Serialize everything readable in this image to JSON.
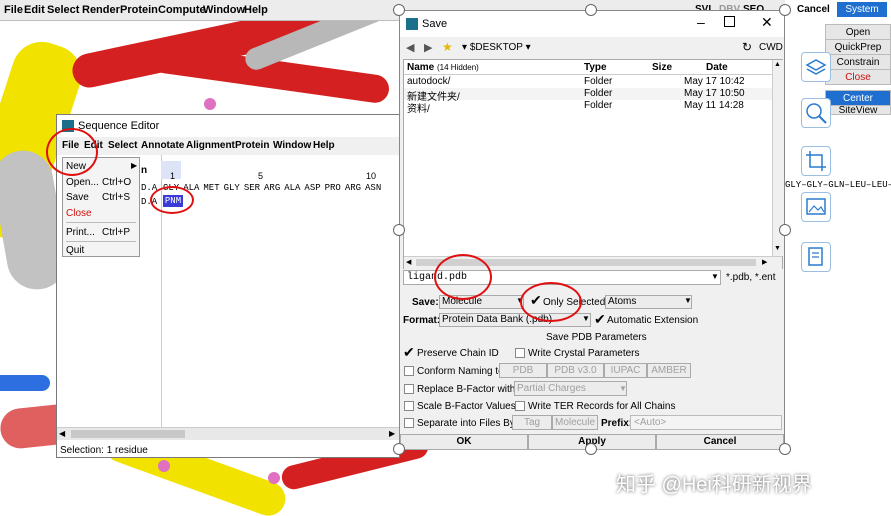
{
  "main_menu": [
    "File",
    "Edit",
    "Select",
    "Render",
    "Protein",
    "Compute",
    "Window",
    "Help"
  ],
  "right_panel": {
    "top_labels": [
      "SVL",
      "DBV",
      "SEQ"
    ],
    "cancel": "Cancel",
    "system": "System",
    "buttons": [
      "Open",
      "QuickPrep",
      "Constrain",
      "Close",
      "Center",
      "SiteView"
    ]
  },
  "seq_editor": {
    "title": "Sequence Editor",
    "menu": [
      "File",
      "Edit",
      "Select",
      "Annotate",
      "Alignment",
      "Protein",
      "Window",
      "Help"
    ],
    "dropdown": [
      {
        "label": "New",
        "shortcut": ""
      },
      {
        "label": "Open...",
        "shortcut": "Ctrl+O"
      },
      {
        "label": "Save",
        "shortcut": "Ctrl+S"
      },
      {
        "label": "Close",
        "shortcut": ""
      },
      {
        "label": "Print...",
        "shortcut": "Ctrl+P"
      },
      {
        "label": "Quit",
        "shortcut": ""
      }
    ],
    "ruler": [
      "1",
      "5",
      "10"
    ],
    "chain_label": "n",
    "row_prefix_1": "D.A",
    "row_prefix_2": "D.A",
    "residues": [
      "GLY",
      "ALA",
      "MET",
      "GLY",
      "SER",
      "ARG",
      "ALA",
      "ASP",
      "PRO",
      "ARG",
      "ASN"
    ],
    "ligand": "PNM",
    "status": "Selection:  1 residue",
    "right_seq": "GLY–GLY–GLN–LEU–LEU–"
  },
  "save_dialog": {
    "title": "Save",
    "path": "$DESKTOP",
    "cwd": "CWD",
    "columns": {
      "name": "Name",
      "hidden": "(14 Hidden)",
      "type": "Type",
      "size": "Size",
      "date": "Date"
    },
    "files": [
      {
        "name": "autodock/",
        "type": "Folder",
        "size": "",
        "date": "May 17 10:42"
      },
      {
        "name": "新建文件夹/",
        "type": "Folder",
        "size": "",
        "date": "May 17 10:50"
      },
      {
        "name": "资料/",
        "type": "Folder",
        "size": "",
        "date": "May 11 14:28"
      }
    ],
    "filename": "ligand.pdb",
    "filter": "*.pdb, *.ent",
    "save_label": "Save:",
    "save_value": "Molecule",
    "only_selected": "Only Selected",
    "atoms": "Atoms",
    "format_label": "Format:",
    "format_value": "Protein Data Bank (.pdb)",
    "auto_ext": "Automatic Extension",
    "section": "Save PDB Parameters",
    "preserve_chain": "Preserve Chain ID",
    "write_crystal": "Write Crystal Parameters",
    "conform_naming": "Conform Naming to:",
    "naming_opts": [
      "PDB",
      "PDB v3.0",
      "IUPAC",
      "AMBER"
    ],
    "replace_bfactor": "Replace B-Factor with",
    "partial_charges": "Partial Charges",
    "scale_bfactor": "Scale B-Factor Values",
    "write_ter": "Write TER Records for All Chains",
    "separate": "Separate into Files By:",
    "tag": "Tag",
    "molecule": "Molecule",
    "prefix": "Prefix:",
    "prefix_placeholder": "<Auto>",
    "ok": "OK",
    "apply": "Apply",
    "cancel": "Cancel"
  },
  "watermark": "知乎 @Hei科研新视界"
}
